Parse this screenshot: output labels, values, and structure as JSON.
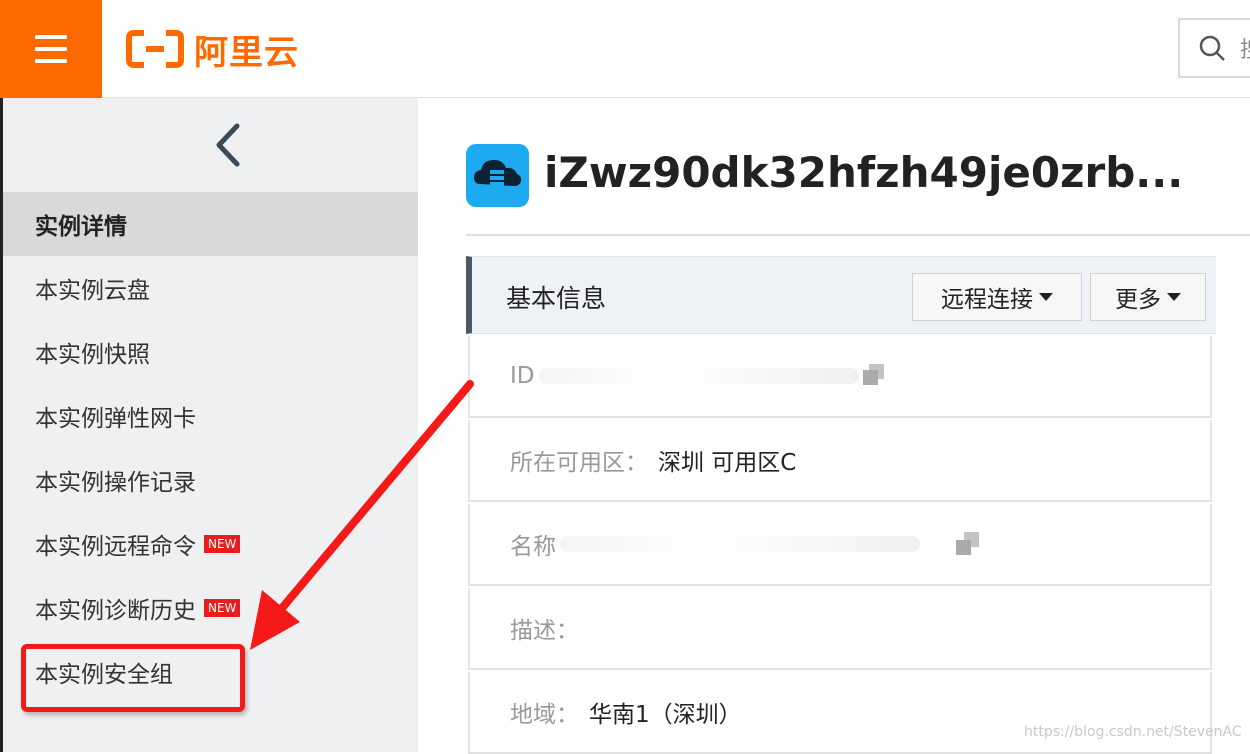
{
  "header": {
    "menu_icon": "hamburger-icon",
    "logo_text": "阿里云",
    "search_icon": "search-icon",
    "search_placeholder_fragment": "搜"
  },
  "sidebar": {
    "collapse_icon": "chevron-left-icon",
    "items": [
      {
        "label": "实例详情",
        "active": true
      },
      {
        "label": "本实例云盘"
      },
      {
        "label": "本实例快照"
      },
      {
        "label": "本实例弹性网卡"
      },
      {
        "label": "本实例操作记录"
      },
      {
        "label": "本实例远程命令",
        "badge": "NEW"
      },
      {
        "label": "本实例诊断历史",
        "badge": "NEW"
      },
      {
        "label": "本实例安全组",
        "highlighted": true
      }
    ]
  },
  "instance": {
    "icon": "cloud-server-icon",
    "title": "iZwz90dk32hfzh49je0zrb..."
  },
  "basic_info": {
    "title": "基本信息",
    "remote_connect": "远程连接",
    "more": "更多",
    "rows": [
      {
        "label": "ID",
        "value": ""
      },
      {
        "label": "所在可用区：",
        "value": "深圳 可用区C"
      },
      {
        "label": "名称",
        "value": ""
      },
      {
        "label": "描述：",
        "value": ""
      },
      {
        "label": "地域：",
        "value": "华南1（深圳）"
      }
    ]
  },
  "watermark": "https://blog.csdn.net/StevenAC",
  "colors": {
    "brand_orange": "#ff6a00",
    "annotation_red": "#f41a1a",
    "badge_red": "#e61e1e",
    "instance_icon_blue": "#1eaaf1"
  }
}
